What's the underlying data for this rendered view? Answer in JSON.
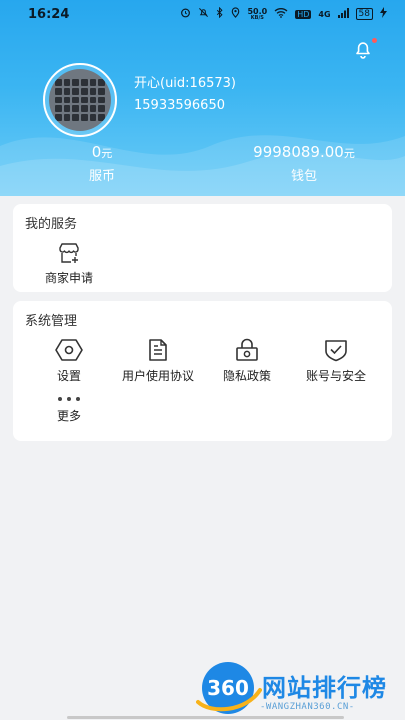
{
  "status_bar": {
    "time": "16:24",
    "net_speed": "50.0",
    "net_unit": "KB/S",
    "hd": "HD",
    "signal": "4G",
    "battery": "58"
  },
  "profile": {
    "name": "开心(uid:16573)",
    "phone": "15933596650",
    "has_notification": true
  },
  "stats": {
    "coins_value": "0",
    "coins_unit": "元",
    "coins_label": "服币",
    "wallet_value": "9998089.00",
    "wallet_unit": "元",
    "wallet_label": "钱包"
  },
  "my_services": {
    "title": "我的服务",
    "items": [
      {
        "label": "商家申请",
        "icon": "store-icon"
      }
    ]
  },
  "system": {
    "title": "系统管理",
    "items": [
      {
        "label": "设置",
        "icon": "hexagon-settings-icon"
      },
      {
        "label": "用户使用协议",
        "icon": "document-icon"
      },
      {
        "label": "隐私政策",
        "icon": "lock-icon"
      },
      {
        "label": "账号与安全",
        "icon": "shield-check-icon"
      },
      {
        "label": "更多",
        "icon": "more-dots-icon"
      }
    ]
  },
  "watermark": {
    "logo_text": "360",
    "title": "网站排行榜",
    "subtitle": "-WANGZHAN360.CN-"
  },
  "colors": {
    "header_top": "#27a7ee",
    "header_bottom": "#6cccf6",
    "background": "#f1f2f4",
    "watermark_blue": "#1e88e5"
  }
}
